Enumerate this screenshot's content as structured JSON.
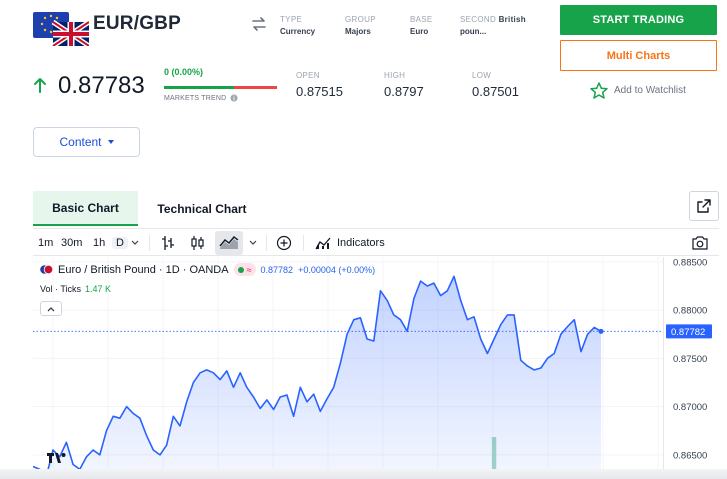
{
  "header": {
    "pair": "EUR/GBP",
    "meta": [
      {
        "key": "TYPE",
        "value": "Currency"
      },
      {
        "key": "GROUP",
        "value": "Majors"
      },
      {
        "key": "BASE",
        "value": "Euro"
      },
      {
        "key": "SECOND",
        "key_bold": "British",
        "value": "poun..."
      }
    ]
  },
  "actions": {
    "start_trading": "START TRADING",
    "multi_charts": "Multi Charts",
    "watchlist": "Add to Watchlist"
  },
  "quote": {
    "price": "0.87783",
    "change": "0 (0.00%)",
    "trend_label": "MARKETS TREND",
    "trend_bullish_fraction": 0.62,
    "stats": [
      {
        "key": "OPEN",
        "value": "0.87515"
      },
      {
        "key": "HIGH",
        "value": "0.8797"
      },
      {
        "key": "LOW",
        "value": "0.87501"
      }
    ]
  },
  "content_dropdown": "Content",
  "tabs": {
    "basic": "Basic Chart",
    "technical": "Technical Chart"
  },
  "toolbar": {
    "intervals": [
      "1m",
      "30m",
      "1h",
      "D"
    ],
    "indicators": "Indicators"
  },
  "chart_legend": {
    "symbol": "Euro / British Pound · 1D · OANDA",
    "price": "0.87782",
    "change": "+0.00004 (+0.00%)",
    "volume_label": "Vol · Ticks",
    "volume_value": "1.47 K"
  },
  "colors": {
    "accent_green": "#16a34a",
    "accent_orange": "#f97316",
    "line_blue": "#2962ff",
    "down_red": "#ef4444"
  },
  "chart_data": {
    "type": "area",
    "title": "",
    "xlabel": "",
    "ylabel": "",
    "ylim": [
      0.8625,
      0.8855
    ],
    "y_ticks": [
      "0.88500",
      "0.88000",
      "0.87500",
      "0.87000",
      "0.86500"
    ],
    "last_value_label": "0.87782",
    "grid": true,
    "series": [
      {
        "values": [
          0.8638,
          0.8635,
          0.8628,
          0.8655,
          0.8648,
          0.8663,
          0.864,
          0.8635,
          0.8648,
          0.8655,
          0.865,
          0.8675,
          0.869,
          0.8688,
          0.87,
          0.8693,
          0.8688,
          0.867,
          0.8655,
          0.865,
          0.866,
          0.869,
          0.868,
          0.8705,
          0.8725,
          0.8735,
          0.8738,
          0.8735,
          0.8728,
          0.8737,
          0.872,
          0.8735,
          0.872,
          0.871,
          0.8698,
          0.8707,
          0.8697,
          0.871,
          0.8712,
          0.869,
          0.872,
          0.8705,
          0.8713,
          0.8695,
          0.8708,
          0.872,
          0.8745,
          0.8775,
          0.879,
          0.8792,
          0.877,
          0.8768,
          0.882,
          0.881,
          0.8795,
          0.879,
          0.8778,
          0.8812,
          0.883,
          0.8825,
          0.8828,
          0.8815,
          0.882,
          0.8835,
          0.881,
          0.879,
          0.8793,
          0.877,
          0.8755,
          0.877,
          0.8785,
          0.8795,
          0.8795,
          0.8748,
          0.8742,
          0.8738,
          0.874,
          0.875,
          0.8755,
          0.8775,
          0.8783,
          0.879,
          0.8757,
          0.8775,
          0.8782,
          0.8778
        ]
      }
    ]
  }
}
